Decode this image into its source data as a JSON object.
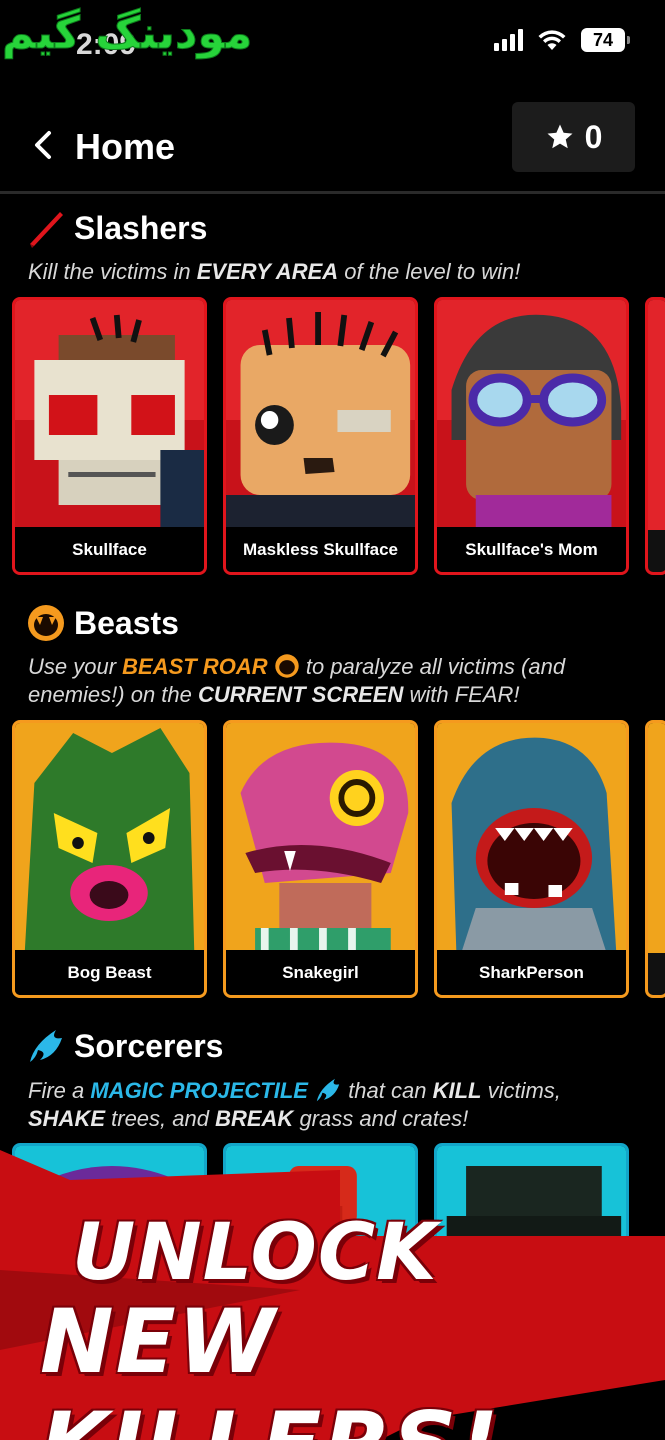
{
  "status_bar": {
    "watermark": "مودینگ گیم",
    "time": "2:09",
    "battery": "74"
  },
  "header": {
    "title": "Home",
    "stars": "0"
  },
  "sections": [
    {
      "title": "Slashers",
      "desc_parts": [
        "Kill the victims in ",
        "EVERY AREA",
        " of the level to win!"
      ],
      "cards": [
        "Skullface",
        "Maskless Skullface",
        "Skullface's Mom"
      ]
    },
    {
      "title": "Beasts",
      "desc_parts": [
        "Use your ",
        "BEAST ROAR",
        " to paralyze all victims (and enemies!) on the ",
        "CURRENT SCREEN",
        " with FEAR!"
      ],
      "cards": [
        "Bog Beast",
        "Snakegirl",
        "SharkPerson"
      ]
    },
    {
      "title": "Sorcerers",
      "desc_parts": [
        "Fire a ",
        "MAGIC PROJECTILE",
        " that can ",
        "KILL",
        " victims, ",
        "SHAKE",
        " trees, and ",
        "BREAK",
        " grass and crates!"
      ],
      "cards": []
    }
  ],
  "banner": {
    "line1": "UNLOCK",
    "line2": "NEW KILLERS!"
  },
  "colors": {
    "slasher_red": "#e0151c",
    "beast_orange": "#f59a1e",
    "sorcerer_blue": "#13a6c9",
    "watermark_green": "#27d43a"
  },
  "icons": [
    "back-chevron-icon",
    "star-icon",
    "blade-icon",
    "beast-mouth-icon",
    "magic-flame-icon"
  ]
}
